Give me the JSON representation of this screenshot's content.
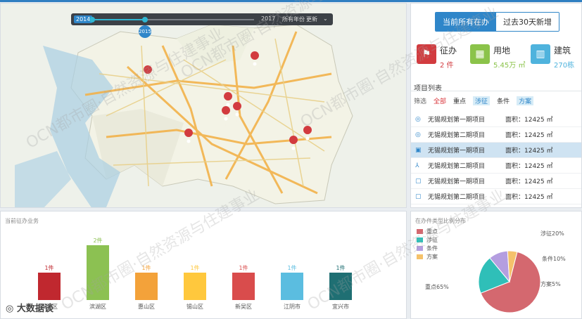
{
  "timeline": {
    "start_year": "2014",
    "end_year": "2017",
    "bubble_year": "2015",
    "buttons": [
      "所有年份",
      "更新"
    ]
  },
  "tabs": [
    "当前所有在办",
    "过去30天新增"
  ],
  "stats": [
    {
      "label": "征办",
      "value": "2 件",
      "color": "#d23b3f",
      "icon": "flag-icon",
      "value_color": "#d23b3f"
    },
    {
      "label": "用地",
      "value": "5.45万 ㎡",
      "color": "#8bc34a",
      "icon": "grid-icon",
      "value_color": "#8bc34a"
    },
    {
      "label": "建筑",
      "value": "270栋",
      "color": "#4fb3dd",
      "icon": "building-icon",
      "value_color": "#4fb3dd"
    }
  ],
  "project_list": {
    "title": "项目列表",
    "filter_label": "筛选",
    "filters": [
      "全部",
      "重点",
      "涉征",
      "条件",
      "方案"
    ],
    "items": [
      {
        "name": "无锡规划第一期项目",
        "area": "面积：12425 ㎡",
        "icon": "target-icon"
      },
      {
        "name": "无锡规划第二期项目",
        "area": "面积：12425 ㎡",
        "icon": "target-icon"
      },
      {
        "name": "无锡规划第一期项目",
        "area": "面积：12425 ㎡",
        "icon": "stamp-icon"
      },
      {
        "name": "无锡规划第二期项目",
        "area": "面积：12425 ㎡",
        "icon": "tree-icon"
      },
      {
        "name": "无锡规划第一期项目",
        "area": "面积：12425 ㎡",
        "icon": "doc-icon"
      },
      {
        "name": "无锡规划第二期项目",
        "area": "面积：12425 ㎡",
        "icon": "doc-icon"
      }
    ]
  },
  "bar_panel": {
    "title": "当前征办业务"
  },
  "pie_panel": {
    "title": "在办件类型比例分布",
    "legend": [
      {
        "name": "重点",
        "color": "#d4686f"
      },
      {
        "name": "涉征",
        "color": "#2fbfb8"
      },
      {
        "name": "条件",
        "color": "#b49ee0"
      },
      {
        "name": "方案",
        "color": "#f5c26b"
      }
    ],
    "slice_labels": [
      "重点65%",
      "涉征20%",
      "条件10%",
      "方案5%"
    ]
  },
  "chart_data": [
    {
      "type": "bar",
      "title": "当前征办业务",
      "categories": [
        "梁溪区",
        "滨湖区",
        "惠山区",
        "锡山区",
        "新吴区",
        "江阴市",
        "宜兴市"
      ],
      "values": [
        1,
        2,
        1,
        1,
        1,
        1,
        1
      ],
      "value_labels": [
        "1件",
        "2件",
        "1件",
        "1件",
        "1件",
        "1件",
        "1件"
      ],
      "colors": [
        "#c0282f",
        "#8cc152",
        "#f3a23a",
        "#ffc83d",
        "#d94c4c",
        "#5bbde0",
        "#1f6f73"
      ]
    },
    {
      "type": "pie",
      "title": "在办件类型比例分布",
      "categories": [
        "重点",
        "涉征",
        "条件",
        "方案"
      ],
      "values": [
        65,
        20,
        10,
        5
      ],
      "colors": [
        "#d4686f",
        "#2fbfb8",
        "#b49ee0",
        "#f5c26b"
      ]
    }
  ],
  "watermark": "OCN都市圈·自然资源与住建事业",
  "logo": "大数据谈"
}
